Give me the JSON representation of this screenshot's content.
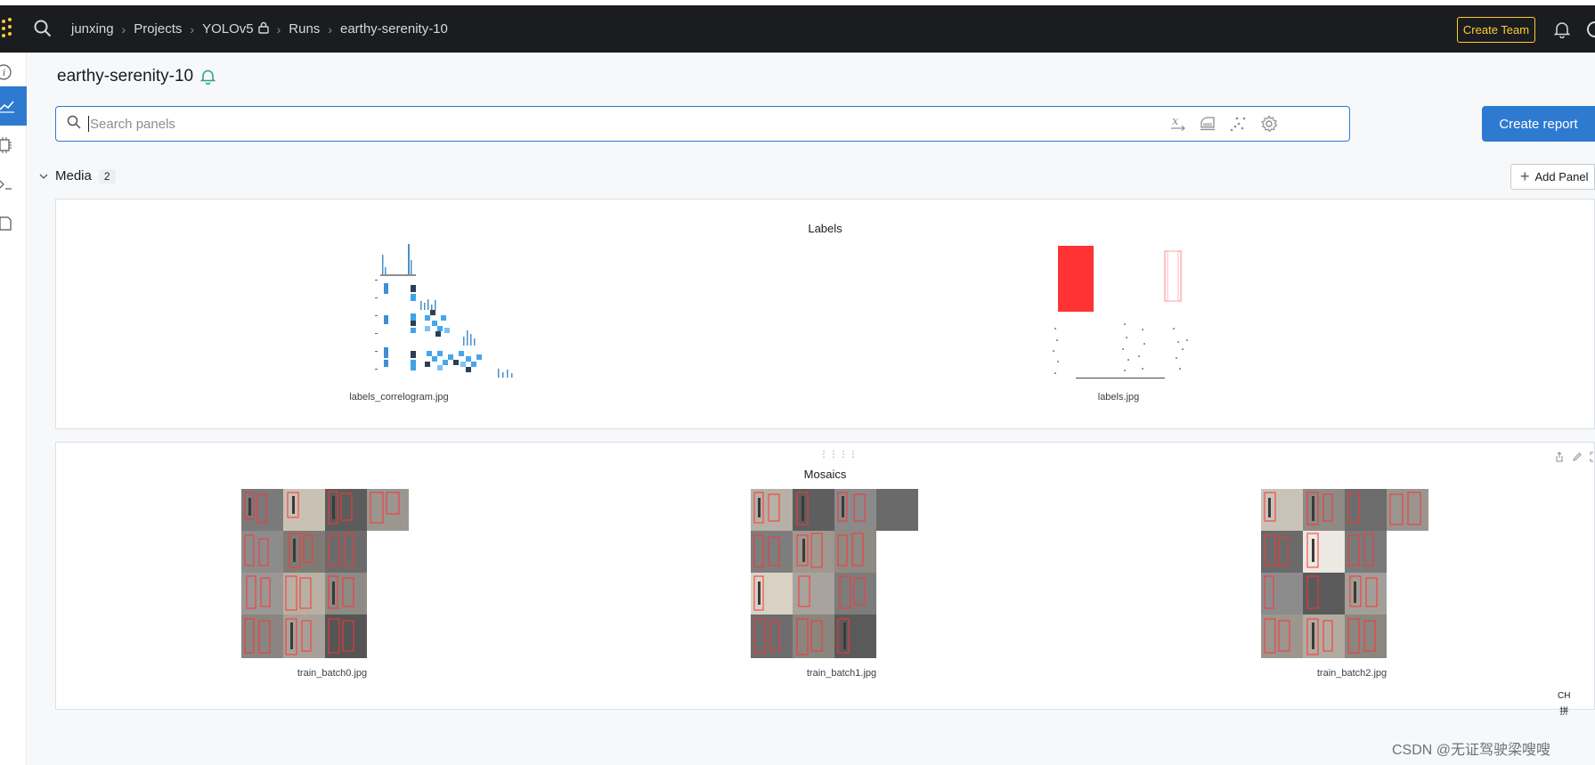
{
  "topbar": {
    "breadcrumbs": [
      "junxing",
      "Projects",
      "YOLOv5",
      "Runs",
      "earthy-serenity-10"
    ],
    "create_team_label": "Create Team"
  },
  "run": {
    "title": "earthy-serenity-10"
  },
  "search": {
    "placeholder": "Search panels",
    "value": ""
  },
  "toolbar": {
    "create_report_label": "Create report",
    "icons": [
      "x-axis-icon",
      "smoothing-icon",
      "outliers-icon",
      "gear-icon"
    ]
  },
  "section": {
    "name": "Media",
    "count": "2",
    "add_panel_label": "Add Panel"
  },
  "panels": [
    {
      "title": "Labels",
      "images": [
        {
          "caption": "labels_correlogram.jpg"
        },
        {
          "caption": "labels.jpg"
        }
      ]
    },
    {
      "title": "Mosaics",
      "images": [
        {
          "caption": "train_batch0.jpg"
        },
        {
          "caption": "train_batch1.jpg"
        },
        {
          "caption": "train_batch2.jpg"
        }
      ]
    }
  ],
  "overlay": {
    "watermark": "CSDN @无证驾驶梁嗖嗖",
    "ime_mode": "CH",
    "ime_char": "拼"
  },
  "colors": {
    "topbar_bg": "#1a1c1f",
    "accent": "#2e7ad1",
    "brand": "#ffcc33",
    "box_red": "#ff3333"
  }
}
